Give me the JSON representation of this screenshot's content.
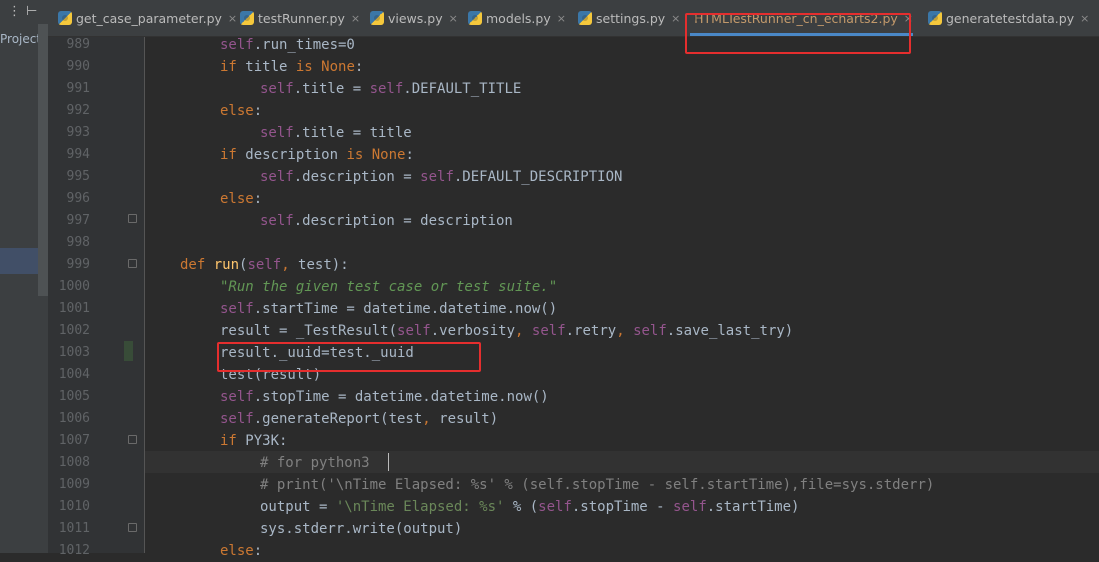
{
  "sidebar": {
    "tool_glyph_1": "⋮",
    "tool_glyph_2": "⊢",
    "project_label": "Project\\"
  },
  "tabs": [
    {
      "label": "get_case_parameter.py",
      "active": false
    },
    {
      "label": "testRunner.py",
      "active": false
    },
    {
      "label": "views.py",
      "active": false
    },
    {
      "label": "models.py",
      "active": false
    },
    {
      "label": "settings.py",
      "active": false
    },
    {
      "label": "HTMLTestRunner_cn_echarts2.py",
      "active": true
    },
    {
      "label": "generatetestdata.py",
      "active": false
    }
  ],
  "tab_close_glyph": "×",
  "colors": {
    "keyword": "#cc7832",
    "self": "#94558d",
    "string": "#6a8759",
    "comment": "#808080",
    "function": "#ffc66d",
    "highlight": "#e52e2e",
    "active_tab": "#c2996b"
  },
  "editor": {
    "cursor_line": 1008,
    "lines": [
      {
        "no": "989",
        "indent": 1,
        "tokens": [
          [
            "slf",
            "self"
          ],
          [
            "",
            ".run_times=0"
          ]
        ]
      },
      {
        "no": "990",
        "indent": 1,
        "tokens": [
          [
            "kw",
            "if"
          ],
          [
            "",
            " title "
          ],
          [
            "kw",
            "is"
          ],
          [
            "",
            " "
          ],
          [
            "kw",
            "None"
          ],
          [
            "",
            ":"
          ]
        ]
      },
      {
        "no": "991",
        "indent": 2,
        "tokens": [
          [
            "slf",
            "self"
          ],
          [
            "",
            ".title = "
          ],
          [
            "slf",
            "self"
          ],
          [
            "",
            ".DEFAULT_TITLE"
          ]
        ]
      },
      {
        "no": "992",
        "indent": 1,
        "tokens": [
          [
            "kw",
            "else"
          ],
          [
            "",
            ":"
          ]
        ]
      },
      {
        "no": "993",
        "indent": 2,
        "tokens": [
          [
            "slf",
            "self"
          ],
          [
            "",
            ".title = title"
          ]
        ]
      },
      {
        "no": "994",
        "indent": 1,
        "tokens": [
          [
            "kw",
            "if"
          ],
          [
            "",
            " description "
          ],
          [
            "kw",
            "is"
          ],
          [
            "",
            " "
          ],
          [
            "kw",
            "None"
          ],
          [
            "",
            ":"
          ]
        ]
      },
      {
        "no": "995",
        "indent": 2,
        "tokens": [
          [
            "slf",
            "self"
          ],
          [
            "",
            ".description = "
          ],
          [
            "slf",
            "self"
          ],
          [
            "",
            ".DEFAULT_DESCRIPTION"
          ]
        ]
      },
      {
        "no": "996",
        "indent": 1,
        "tokens": [
          [
            "kw",
            "else"
          ],
          [
            "",
            ":"
          ]
        ]
      },
      {
        "no": "997",
        "indent": 2,
        "tokens": [
          [
            "slf",
            "self"
          ],
          [
            "",
            ".description = description"
          ]
        ]
      },
      {
        "no": "998",
        "indent": 0,
        "tokens": []
      },
      {
        "no": "999",
        "indent": 0,
        "tokens": [
          [
            "kw",
            "def"
          ],
          [
            "",
            " "
          ],
          [
            "fn",
            "run"
          ],
          [
            "",
            "("
          ],
          [
            "slf",
            "self"
          ],
          [
            "kw",
            ","
          ],
          [
            "",
            " test):"
          ]
        ]
      },
      {
        "no": "1000",
        "indent": 1,
        "tokens": [
          [
            "doc",
            "\"Run the given test case or test suite.\""
          ]
        ]
      },
      {
        "no": "1001",
        "indent": 1,
        "tokens": [
          [
            "slf",
            "self"
          ],
          [
            "",
            ".startTime = datetime.datetime.now()"
          ]
        ]
      },
      {
        "no": "1002",
        "indent": 1,
        "tokens": [
          [
            "",
            "result = _TestResult("
          ],
          [
            "slf",
            "self"
          ],
          [
            "",
            ".verbosity"
          ],
          [
            "kw",
            ","
          ],
          [
            "",
            " "
          ],
          [
            "slf",
            "self"
          ],
          [
            "",
            ".retry"
          ],
          [
            "kw",
            ","
          ],
          [
            "",
            " "
          ],
          [
            "slf",
            "self"
          ],
          [
            "",
            ".save_last_try)"
          ]
        ]
      },
      {
        "no": "1003",
        "indent": 1,
        "tokens": [
          [
            "",
            "result._uuid=test._uuid"
          ]
        ]
      },
      {
        "no": "1004",
        "indent": 1,
        "tokens": [
          [
            "",
            "test(result)"
          ]
        ]
      },
      {
        "no": "1005",
        "indent": 1,
        "tokens": [
          [
            "slf",
            "self"
          ],
          [
            "",
            ".stopTime = datetime.datetime.now()"
          ]
        ]
      },
      {
        "no": "1006",
        "indent": 1,
        "tokens": [
          [
            "slf",
            "self"
          ],
          [
            "",
            ".generateReport(test"
          ],
          [
            "kw",
            ","
          ],
          [
            "",
            " result)"
          ]
        ]
      },
      {
        "no": "1007",
        "indent": 1,
        "tokens": [
          [
            "kw",
            "if"
          ],
          [
            "",
            " PY3K:"
          ]
        ]
      },
      {
        "no": "1008",
        "indent": 2,
        "tokens": [
          [
            "cmt",
            "# for python3"
          ]
        ]
      },
      {
        "no": "1009",
        "indent": 2,
        "tokens": [
          [
            "cmt",
            "# print('\\nTime Elapsed: %s' % (self.stopTime - self.startTime),file=sys.stderr)"
          ]
        ]
      },
      {
        "no": "1010",
        "indent": 2,
        "tokens": [
          [
            "",
            "output = "
          ],
          [
            "str",
            "'\\nTime Elapsed: %s'"
          ],
          [
            "",
            " % ("
          ],
          [
            "slf",
            "self"
          ],
          [
            "",
            ".stopTime - "
          ],
          [
            "slf",
            "self"
          ],
          [
            "",
            ".startTime)"
          ]
        ]
      },
      {
        "no": "1011",
        "indent": 2,
        "tokens": [
          [
            "",
            "sys.stderr.write(output)"
          ]
        ]
      },
      {
        "no": "1012",
        "indent": 1,
        "tokens": [
          [
            "kw",
            "else"
          ],
          [
            "",
            ":"
          ]
        ]
      }
    ]
  }
}
